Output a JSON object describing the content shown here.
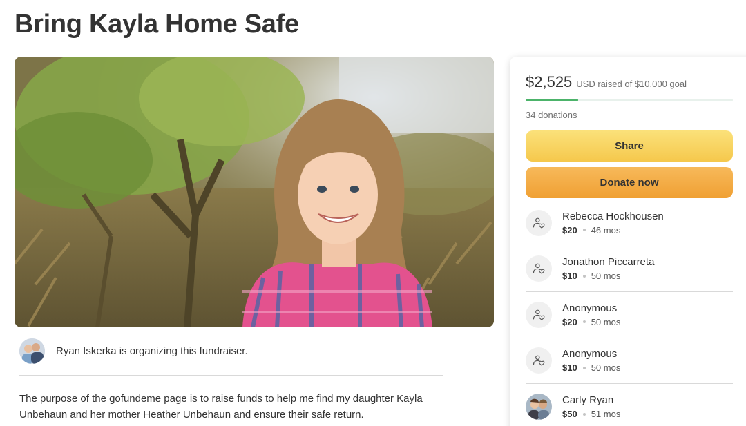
{
  "page": {
    "title": "Bring Kayla Home Safe"
  },
  "organizer": {
    "text": "Ryan Iskerka is organizing this fundraiser."
  },
  "story": {
    "text": "The purpose of the gofundeme page is to raise funds to help me find my daughter Kayla Unbehaun and her mother Heather Unbehaun and ensure their safe return."
  },
  "donation_card": {
    "raised": "$2,525",
    "raised_sub": "USD raised of $10,000 goal",
    "progress_fraction": 0.2525,
    "donations_count": "34 donations",
    "share_label": "Share",
    "donate_label": "Donate now",
    "donors": [
      {
        "name": "Rebecca Hockhousen",
        "amount": "$20",
        "time": "46 mos",
        "avatar": "heart-hand-icon"
      },
      {
        "name": "Jonathon Piccarreta",
        "amount": "$10",
        "time": "50 mos",
        "avatar": "heart-hand-icon"
      },
      {
        "name": "Anonymous",
        "amount": "$20",
        "time": "50 mos",
        "avatar": "heart-hand-icon"
      },
      {
        "name": "Anonymous",
        "amount": "$10",
        "time": "50 mos",
        "avatar": "heart-hand-icon"
      },
      {
        "name": "Carly Ryan",
        "amount": "$50",
        "time": "51 mos",
        "avatar": "photo"
      }
    ]
  },
  "colors": {
    "progress": "#4cb36a",
    "share_button": "#f5c84c",
    "donate_button": "#f0a033"
  }
}
